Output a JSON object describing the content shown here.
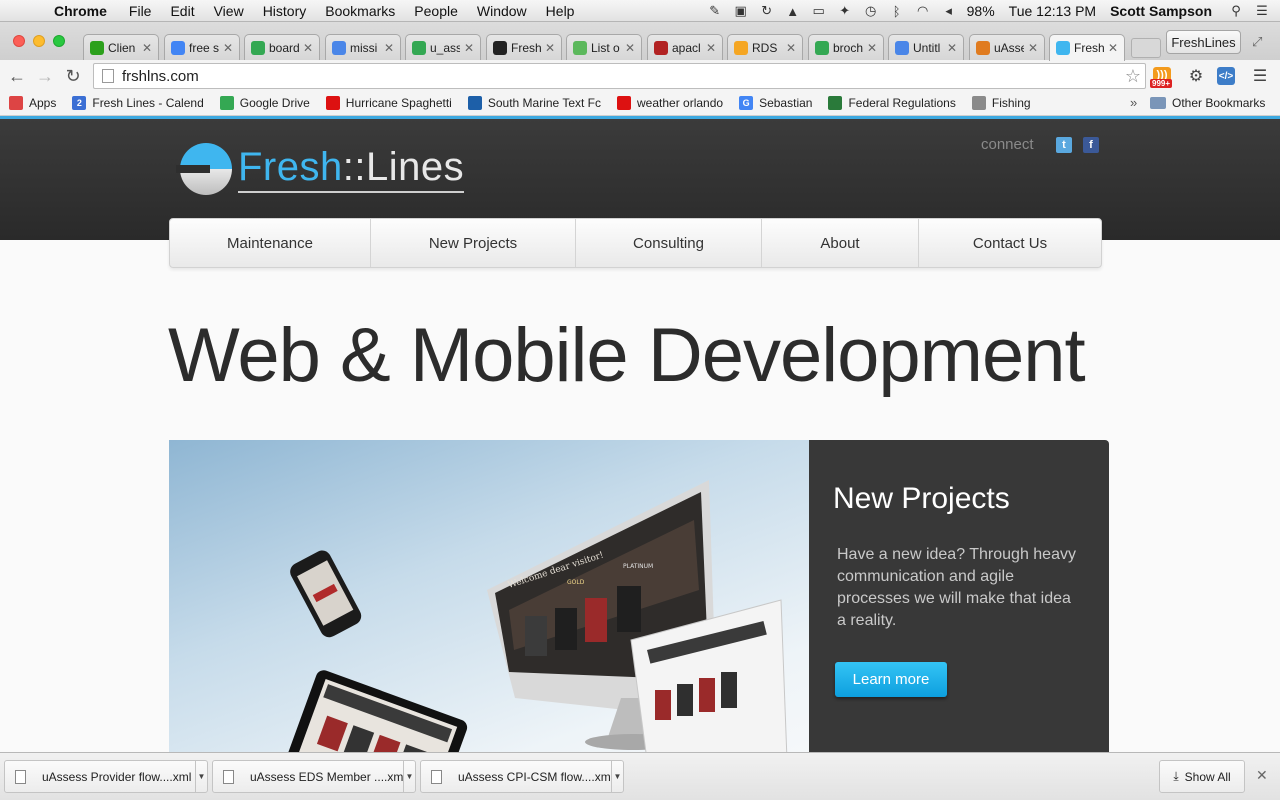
{
  "menubar": {
    "app": "Chrome",
    "items": [
      "File",
      "Edit",
      "View",
      "History",
      "Bookmarks",
      "People",
      "Window",
      "Help"
    ],
    "battery": "98%",
    "clock": "Tue 12:13 PM",
    "user": "Scott Sampson",
    "status_icons": [
      "pen-icon",
      "box-icon",
      "sync-icon",
      "drive-icon",
      "battery-icon",
      "evernote-icon",
      "time-machine-icon",
      "bluetooth-icon",
      "wifi-icon",
      "volume-icon"
    ]
  },
  "tabs": [
    {
      "title": "Clien",
      "favicon": "quickbooks-icon",
      "color": "#2ca01c"
    },
    {
      "title": "free s",
      "favicon": "google-icon",
      "color": "#4285f4"
    },
    {
      "title": "board",
      "favicon": "drive-icon",
      "color": "#34a853"
    },
    {
      "title": "missi",
      "favicon": "docs-icon",
      "color": "#4a86e8"
    },
    {
      "title": "u_ass",
      "favicon": "drive-icon",
      "color": "#34a853"
    },
    {
      "title": "Fresh",
      "favicon": "github-icon",
      "color": "#222222"
    },
    {
      "title": "List o",
      "favicon": "bootstrap-icon",
      "color": "#5cb85c"
    },
    {
      "title": "apacl",
      "favicon": "apache-icon",
      "color": "#b22222"
    },
    {
      "title": "RDS ·",
      "favicon": "aws-icon",
      "color": "#f5a623"
    },
    {
      "title": "broch",
      "favicon": "drive-icon",
      "color": "#34a853"
    },
    {
      "title": "Untitl",
      "favicon": "docs-icon",
      "color": "#4a86e8"
    },
    {
      "title": "uAsse",
      "favicon": "uassess-icon",
      "color": "#e07b1f"
    },
    {
      "title": "Fresh",
      "favicon": "freshlines-icon",
      "color": "#3fb6ef",
      "active": true
    }
  ],
  "profile_button": "FreshLines",
  "address_bar": {
    "url": "frshlns.com"
  },
  "extensions": {
    "rss_badge": "999+"
  },
  "bookmarks": [
    {
      "label": "Apps",
      "icon": "apps-grid-icon",
      "color": "#d44"
    },
    {
      "label": "Fresh Lines - Calend",
      "icon": "calendar-icon",
      "color": "#3b6fd4",
      "glyph": "2"
    },
    {
      "label": "Google Drive",
      "icon": "drive-icon",
      "color": "#34a853"
    },
    {
      "label": "Hurricane Spaghetti",
      "icon": "red-square-icon",
      "color": "#d11"
    },
    {
      "label": "South Marine Text Fc",
      "icon": "noaa-icon",
      "color": "#1d5fa8"
    },
    {
      "label": "weather orlando",
      "icon": "red-square-icon",
      "color": "#d11"
    },
    {
      "label": "Sebastian",
      "icon": "google-icon",
      "color": "#4285f4",
      "glyph": "G"
    },
    {
      "label": "Federal Regulations",
      "icon": "globe-icon",
      "color": "#2a7a3a"
    },
    {
      "label": "Fishing",
      "icon": "fishing-icon",
      "color": "#8a8a8a"
    }
  ],
  "other_bookmarks": "Other Bookmarks",
  "site": {
    "logo_left": "Fresh",
    "logo_right": "::Lines",
    "connect": "connect",
    "nav": [
      "Maintenance",
      "New Projects",
      "Consulting",
      "About",
      "Contact Us"
    ],
    "hero_title": "Web & Mobile Development",
    "panel_title": "New Projects",
    "panel_body": "Have a new idea? Through heavy communication and agile processes we will make that idea a reality.",
    "cta": "Learn more",
    "mock_screen_texts": [
      "Welcome dear visitor!",
      "GOLD",
      "PLATINUM"
    ]
  },
  "downloads": [
    {
      "name": "uAssess Provider flow....xml"
    },
    {
      "name": "uAssess EDS Member ....xml"
    },
    {
      "name": "uAssess CPI-CSM flow....xml"
    }
  ],
  "show_all": "Show All"
}
